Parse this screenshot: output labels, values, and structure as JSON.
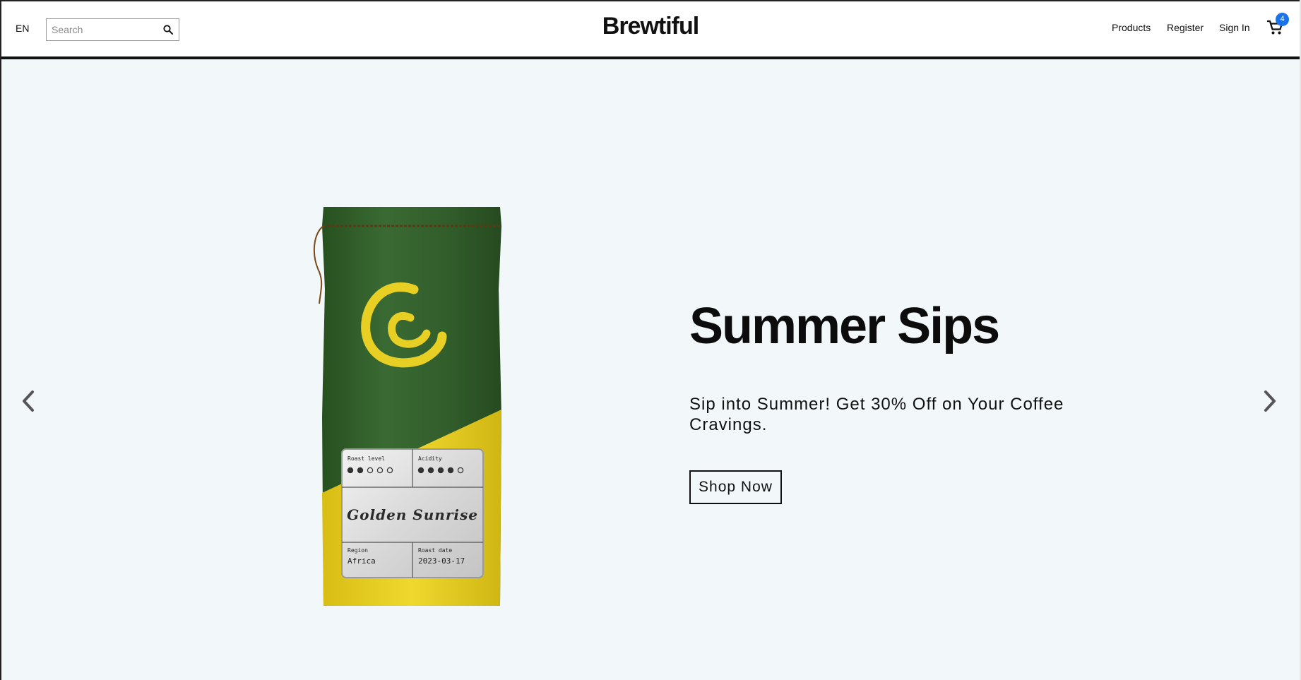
{
  "header": {
    "language": "EN",
    "search": {
      "placeholder": "Search",
      "value": ""
    },
    "brand": "Brewtiful",
    "nav": [
      "Products",
      "Register",
      "Sign In"
    ],
    "cart_count": "4"
  },
  "hero": {
    "title": "Summer Sips",
    "subtitle": "Sip into Summer! Get 30% Off on Your Coffee Cravings.",
    "cta_label": "Shop Now"
  },
  "product_label": {
    "roast_level_label": "Roast level",
    "roast_level": 2,
    "acidity_label": "Acidity",
    "acidity": 4,
    "dots_total": 5,
    "name": "Golden Sunrise",
    "region_label": "Region",
    "region": "Africa",
    "roast_date_label": "Roast date",
    "roast_date": "2023-03-17"
  },
  "colors": {
    "bag_green": "#2f5a2a",
    "bag_yellow": "#e4cc21",
    "accent_blue": "#1a73e8",
    "hero_bg": "#f2f7fa"
  },
  "icons": [
    "search-icon",
    "cart-icon",
    "chevron-left-icon",
    "chevron-right-icon"
  ]
}
